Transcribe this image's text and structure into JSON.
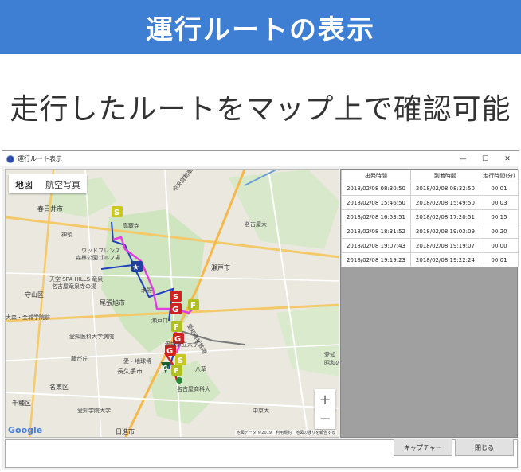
{
  "banner": {
    "title": "運行ルートの表示"
  },
  "subtitle": "走行したルートをマップ上で確認可能",
  "window": {
    "title": "運行ルート表示",
    "controls": {
      "minimize": "—",
      "maximize": "☐",
      "close": "✕"
    }
  },
  "map": {
    "tabs": [
      "地図",
      "航空写真"
    ],
    "zoom_in": "+",
    "zoom_out": "−",
    "logo": "Google",
    "footer": "地図データ ©2019　利用規約　地図の誤りを報告する",
    "labels": [
      "春日井市",
      "高蔵寺",
      "神領",
      "ウッドフレンズ",
      "森林公園ゴルフ場",
      "天空 SPA HILLS 竜泉",
      "名古屋竜泉寺の湯",
      "守山区",
      "尾張旭市",
      "瀬戸市",
      "水野",
      "瀬戸口",
      "名古屋大",
      "大森・金城学院前",
      "愛知医科大学病院",
      "藤が丘",
      "長久手市",
      "愛・地球博",
      "八草",
      "名東区",
      "千種区",
      "愛知学院大学",
      "日進市",
      "愛知県立大学",
      "名古屋商科大",
      "中京大",
      "愛知",
      "昭和の",
      "中央自動車道",
      "愛知環状鉄道"
    ]
  },
  "trips": {
    "headers": [
      "出発時間",
      "到着時間",
      "走行時間(分)"
    ],
    "rows": [
      [
        "2018/02/08 08:30:50",
        "2018/02/08 08:32:50",
        "00:01"
      ],
      [
        "2018/02/08 15:46:50",
        "2018/02/08 15:49:50",
        "00:03"
      ],
      [
        "2018/02/08 16:53:51",
        "2018/02/08 17:20:51",
        "00:15"
      ],
      [
        "2018/02/08 18:31:52",
        "2018/02/08 19:03:09",
        "00:20"
      ],
      [
        "2018/02/08 19:07:43",
        "2018/02/08 19:19:07",
        "00:00"
      ],
      [
        "2018/02/08 19:19:23",
        "2018/02/08 19:22:24",
        "00:01"
      ]
    ]
  },
  "buttons": {
    "capture": "キャプチャー",
    "close": "閉じる"
  },
  "colors": {
    "banner": "#3f7fd3",
    "route_blue": "#2040c0",
    "route_magenta": "#e040e0",
    "marker_start": "#c8c820",
    "marker_goal": "#d02020",
    "marker_fuel": "#b0c020"
  }
}
